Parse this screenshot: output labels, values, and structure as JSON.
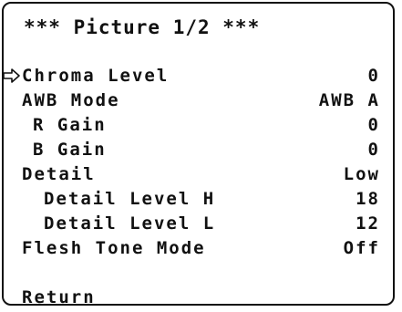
{
  "menu": {
    "title": "*** Picture 1/2 ***",
    "cursor_icon": "arrow-right-outline-icon",
    "selected_index": 0,
    "items": [
      {
        "label": "Chroma Level",
        "value": "0"
      },
      {
        "label": "AWB Mode",
        "value": "AWB A"
      },
      {
        "label": "R Gain",
        "value": "0"
      },
      {
        "label": "B Gain",
        "value": "0"
      },
      {
        "label": "Detail",
        "value": "Low"
      },
      {
        "label": "Detail Level H",
        "value": "18"
      },
      {
        "label": "Detail Level L",
        "value": "12"
      },
      {
        "label": "Flesh Tone Mode",
        "value": "Off"
      }
    ],
    "return_label": "Return"
  },
  "colors": {
    "foreground": "#111111",
    "background": "#ffffff"
  }
}
